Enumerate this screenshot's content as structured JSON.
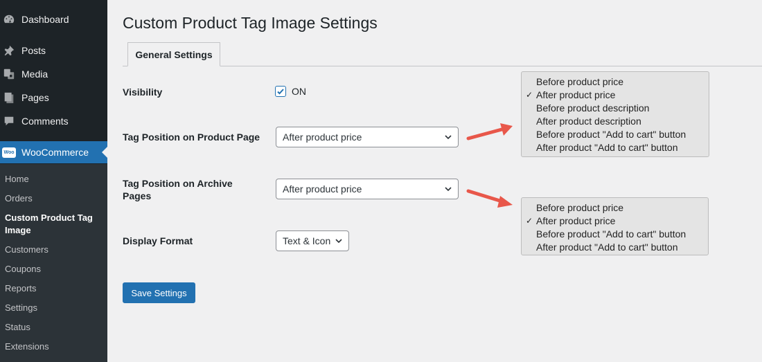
{
  "sidebar": {
    "items": [
      {
        "label": "Dashboard",
        "icon": "dashboard-icon"
      },
      {
        "label": "Posts",
        "icon": "pin-icon"
      },
      {
        "label": "Media",
        "icon": "media-icon"
      },
      {
        "label": "Pages",
        "icon": "pages-icon"
      },
      {
        "label": "Comments",
        "icon": "comments-icon"
      },
      {
        "label": "WooCommerce",
        "icon": "woocommerce-icon",
        "badge": "Woo"
      }
    ],
    "submenu": [
      "Home",
      "Orders",
      "Custom Product Tag Image",
      "Customers",
      "Coupons",
      "Reports",
      "Settings",
      "Status",
      "Extensions"
    ]
  },
  "page": {
    "title": "Custom Product Tag Image Settings",
    "tab": "General Settings"
  },
  "form": {
    "visibility": {
      "label": "Visibility",
      "checked": true,
      "option_label": "ON"
    },
    "product_page_position": {
      "label": "Tag Position on Product Page",
      "value": "After product price"
    },
    "archive_position": {
      "label": "Tag Position on Archive Pages",
      "value": "After product price"
    },
    "display_format": {
      "label": "Display Format",
      "value": "Text & Icon"
    },
    "save_label": "Save Settings"
  },
  "dropdown_product_page": {
    "options": [
      "Before product price",
      "After product price",
      "Before product description",
      "After product description",
      "Before product \"Add to cart\" button",
      "After product \"Add to cart\" button"
    ],
    "selected_index": 1
  },
  "dropdown_archive": {
    "options": [
      "Before product price",
      "After product price",
      "Before product \"Add to cart\" button",
      "After product \"Add to cart\" button"
    ],
    "selected_index": 1
  },
  "colors": {
    "accent": "#2271b1",
    "sidebar_bg": "#1d2327",
    "annotation_arrow": "#e8574a"
  },
  "tick_glyph": "✓"
}
